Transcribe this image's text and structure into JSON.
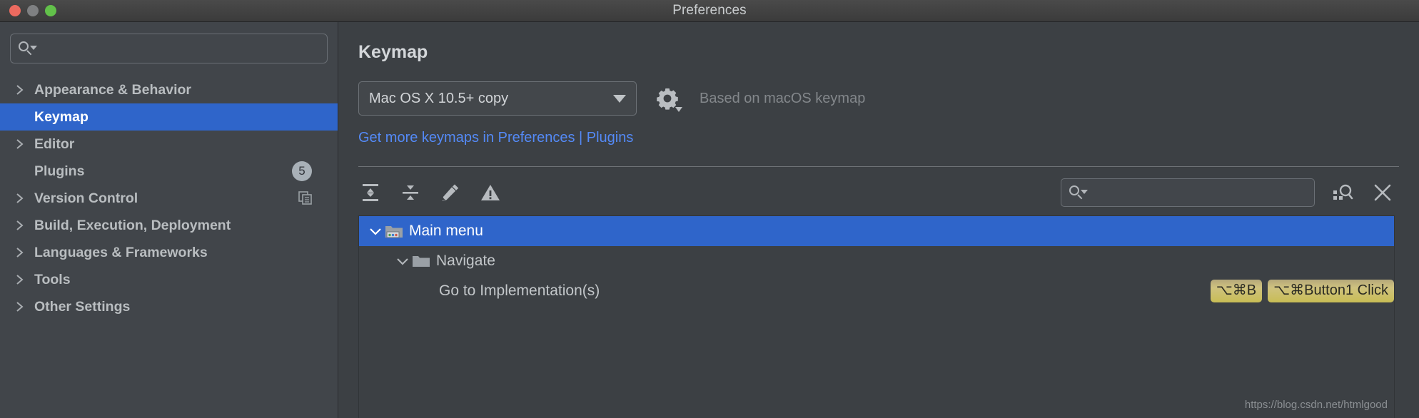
{
  "window": {
    "title": "Preferences",
    "traffic_lights": [
      "close-button",
      "minimize-button",
      "maximize-button"
    ],
    "colors": {
      "close": "#ec6a5f",
      "minimize": "#7f8082",
      "maximize": "#62c14a",
      "accent_selection": "#2f65ca",
      "link": "#548af7",
      "shortcut_badge": "#c8bd55",
      "sidebar_bg": "#41454a",
      "main_bg": "#3c4044"
    }
  },
  "sidebar": {
    "search": {
      "value": "",
      "placeholder": "",
      "icon": "search-icon"
    },
    "items": [
      {
        "label": "Appearance & Behavior",
        "expandable": true,
        "selected": false,
        "badge": null,
        "right_icon": null
      },
      {
        "label": "Keymap",
        "expandable": false,
        "selected": true,
        "badge": null,
        "right_icon": null
      },
      {
        "label": "Editor",
        "expandable": true,
        "selected": false,
        "badge": null,
        "right_icon": null
      },
      {
        "label": "Plugins",
        "expandable": false,
        "selected": false,
        "badge": "5",
        "right_icon": null
      },
      {
        "label": "Version Control",
        "expandable": true,
        "selected": false,
        "badge": null,
        "right_icon": "copy-icon"
      },
      {
        "label": "Build, Execution, Deployment",
        "expandable": true,
        "selected": false,
        "badge": null,
        "right_icon": null
      },
      {
        "label": "Languages & Frameworks",
        "expandable": true,
        "selected": false,
        "badge": null,
        "right_icon": null
      },
      {
        "label": "Tools",
        "expandable": true,
        "selected": false,
        "badge": null,
        "right_icon": null
      },
      {
        "label": "Other Settings",
        "expandable": true,
        "selected": false,
        "badge": null,
        "right_icon": null
      }
    ]
  },
  "main": {
    "page_title": "Keymap",
    "keymap_select": {
      "value": "Mac OS X 10.5+ copy",
      "options": [
        "Mac OS X 10.5+ copy"
      ]
    },
    "gear_button": "settings-gear",
    "based_on": "Based on macOS keymap",
    "plugins_link": "Get more keymaps in Preferences | Plugins",
    "toolbar": {
      "expand_all": "Expand All",
      "collapse_all": "Collapse All",
      "edit_shortcut": "Edit Shortcut",
      "conflicts": "Show Conflicts",
      "search": {
        "value": "",
        "placeholder": ""
      },
      "find_by_shortcut": "Find Actions by Shortcut",
      "clear": "Clear Search"
    },
    "tree": [
      {
        "label": "Main menu",
        "depth": 0,
        "expanded": true,
        "selected": true,
        "icon": "main-menu-icon",
        "shortcuts": []
      },
      {
        "label": "Navigate",
        "depth": 1,
        "expanded": true,
        "selected": false,
        "icon": "folder-icon",
        "shortcuts": []
      },
      {
        "label": "Go to Implementation(s)",
        "depth": 2,
        "expanded": null,
        "selected": false,
        "icon": null,
        "shortcuts": [
          "⌥⌘B",
          "⌥⌘Button1 Click"
        ]
      }
    ]
  },
  "watermark": "https://blog.csdn.net/htmlgood"
}
